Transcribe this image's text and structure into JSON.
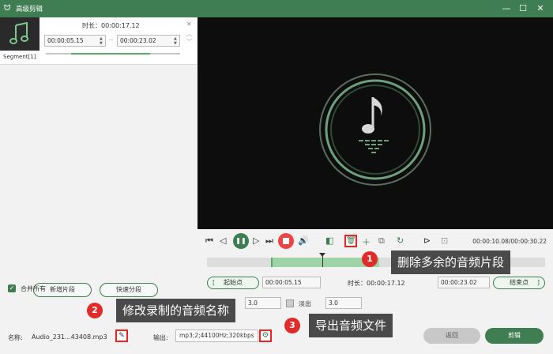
{
  "window": {
    "title": "高级剪辑",
    "app_icon": "rabbit-icon",
    "controls": [
      "minimize",
      "maximize",
      "close"
    ]
  },
  "segment_list": {
    "items": [
      {
        "label": "Segment[1]",
        "duration_label": "时长：00:00:17.12",
        "start": "00:00:05.15",
        "separator": "--",
        "end": "00:00:23.02",
        "thumbnail_icon": "music-note-icon"
      }
    ],
    "add_segment_label": "新增片段",
    "quick_split_label": "快速分段",
    "merge_all_label": "合并所有",
    "merge_all_checked": true
  },
  "preview": {
    "icon": "music-note-disc-icon"
  },
  "playback": {
    "time_readout": "00:00:10.08/00:00:30.22",
    "selection_start_fraction": 0.19,
    "selection_end_fraction": 0.51,
    "cursor_fraction": 0.34
  },
  "trim": {
    "start_point_label": "起始点",
    "start_value": "00:00:05.15",
    "duration_label": "时长：00:00:17.12",
    "end_value": "00:00:23.02",
    "end_point_label": "结束点"
  },
  "fade": {
    "fade_in_value": "3.0",
    "fade_out_label": "淡出",
    "fade_out_value": "3.0"
  },
  "bottom": {
    "name_label": "名称:",
    "filename": "Audio_231...43408.mp3",
    "output_label": "输出:",
    "output_value": "mp3;2;44100Hz;320kbps",
    "back_label": "返回",
    "cut_label": "剪辑"
  },
  "annotations": [
    {
      "number": "1",
      "text": "删除多余的音频片段"
    },
    {
      "number": "2",
      "text": "修改录制的音频名称"
    },
    {
      "number": "3",
      "text": "导出音频文件"
    }
  ],
  "colors": {
    "brand_green": "#3f7d53",
    "highlight_red": "#e12a2a",
    "annotation_bg": "#4a4a4a"
  }
}
